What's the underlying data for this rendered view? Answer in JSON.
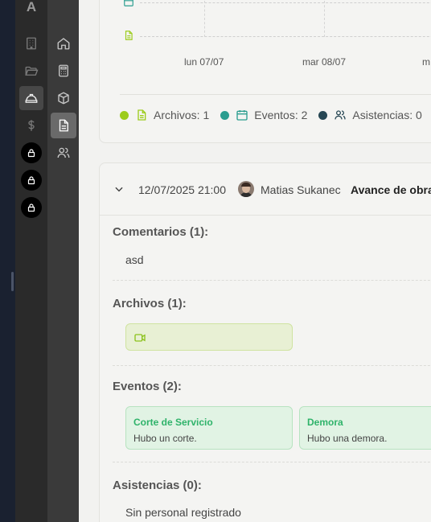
{
  "app": {
    "logo_letter": "A"
  },
  "timeline": {
    "days": [
      "lun 07/07",
      "mar 08/07",
      "m"
    ]
  },
  "legend": {
    "files": {
      "label": "Archivos: 1",
      "color": "#9ccc1c"
    },
    "events": {
      "label": "Eventos: 2",
      "color": "#2a9d8f"
    },
    "attendance": {
      "label": "Asistencias: 0",
      "color": "#264653"
    }
  },
  "entry": {
    "timestamp": "12/07/2025 21:00",
    "author": "Matias Sukanec",
    "type": "Avance de obra",
    "comments": {
      "title": "Comentarios (1):",
      "items": [
        "asd"
      ]
    },
    "files": {
      "title": "Archivos (1):"
    },
    "events": {
      "title": "Eventos (2):",
      "items": [
        {
          "title": "Corte de Servicio",
          "desc": "Hubo un corte."
        },
        {
          "title": "Demora",
          "desc": "Hubo una demora."
        }
      ]
    },
    "attendance": {
      "title": "Asistencias (0):",
      "empty": "Sin personal registrado"
    }
  }
}
